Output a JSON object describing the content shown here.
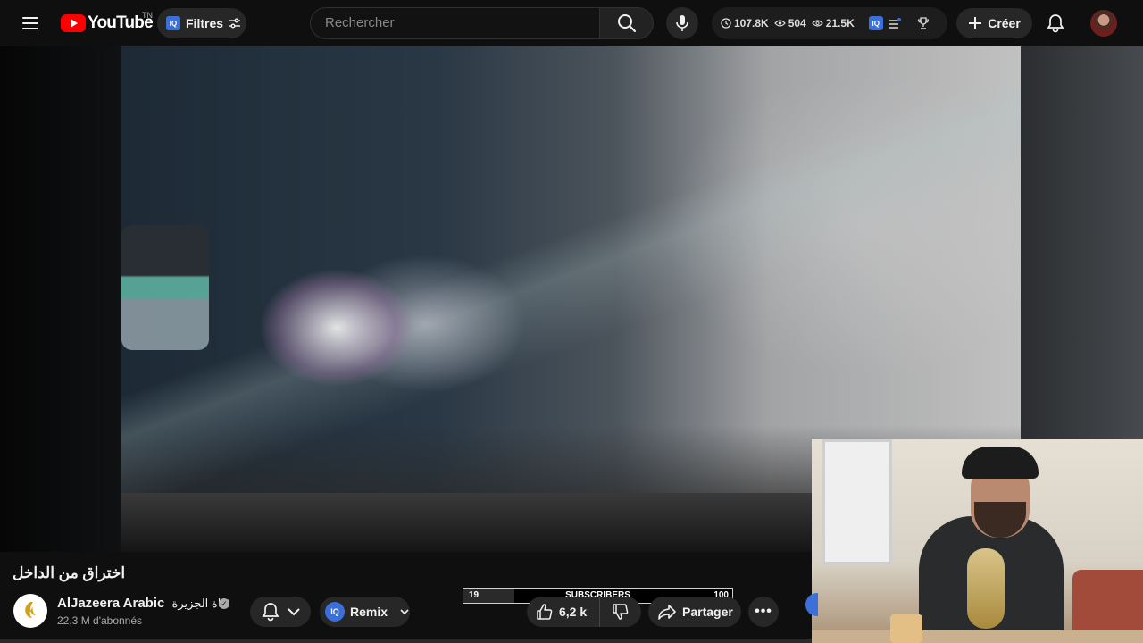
{
  "header": {
    "logo_text": "YouTube",
    "logo_superscript": "TN",
    "filters_label": "Filtres",
    "search_placeholder": "Rechercher",
    "stats": {
      "views": "107.8K",
      "viewers": "504",
      "watchers": "21.5K"
    },
    "create_label": "Créer"
  },
  "video": {
    "title": "اختراق من الداخل"
  },
  "channel": {
    "name": "AlJazeera Arabic",
    "name_arabic": "قناة الجزيرة",
    "subscribers": "22,3 M d'abonnés"
  },
  "actions": {
    "remix_label": "Remix",
    "like_count": "6,2 k",
    "share_label": "Partager"
  },
  "subscriber_goal": {
    "current": "19",
    "label": "SUBSCRIBERS",
    "goal": "100",
    "progress": 0.19
  },
  "colors": {
    "brand": "#ff0000",
    "accent": "#3b6fd9",
    "background": "#0f0f0f",
    "pill": "#272727"
  }
}
